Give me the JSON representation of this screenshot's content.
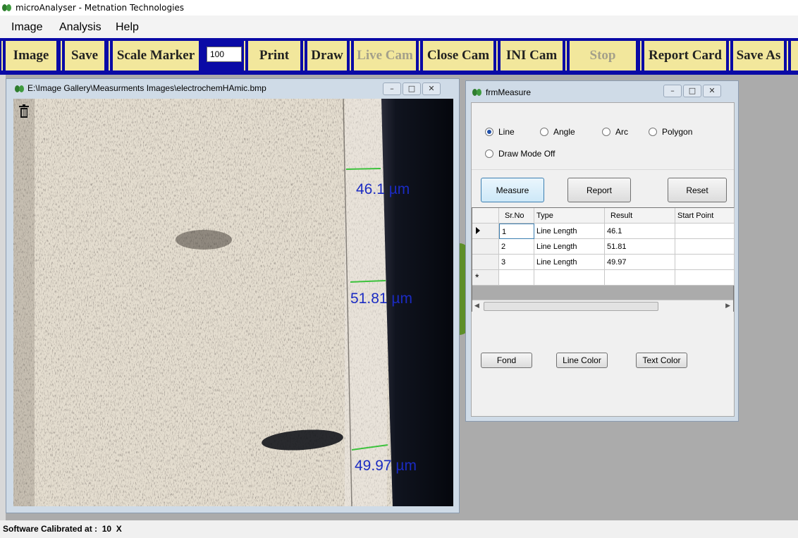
{
  "app": {
    "title": "microAnalyser - Metnation Technologies"
  },
  "menu": [
    "Image",
    "Analysis",
    "Help"
  ],
  "toolbar": {
    "buttons": [
      {
        "label": "Image"
      },
      {
        "label": "Save"
      },
      {
        "label": "Scale Marker"
      },
      {
        "label": "Print"
      },
      {
        "label": "Draw"
      },
      {
        "label": "Live Cam"
      },
      {
        "label": "Close Cam"
      },
      {
        "label": "INI Cam"
      },
      {
        "label": "Stop"
      },
      {
        "label": "Report Card"
      },
      {
        "label": "Save As"
      }
    ],
    "scale_value": "100"
  },
  "image_window": {
    "title": "E:\\Image Gallery\\Measurments Images\\electrochemHAmic.bmp",
    "measurements": [
      "46.1  µm",
      "51.81  µm",
      "49.97  µm"
    ]
  },
  "measure_window": {
    "title": "frmMeasure",
    "radios": [
      {
        "label": "Line",
        "selected": true
      },
      {
        "label": "Angle",
        "selected": false
      },
      {
        "label": "Arc",
        "selected": false
      },
      {
        "label": "Polygon",
        "selected": false
      },
      {
        "label": "Draw Mode Off",
        "selected": false
      }
    ],
    "buttons": {
      "measure": "Measure",
      "report": "Report",
      "reset": "Reset",
      "fond": "Fond",
      "line_color": "Line Color",
      "text_color": "Text Color"
    },
    "grid": {
      "columns": [
        "Sr.No",
        "Type",
        "Result",
        "Start Point"
      ],
      "rows": [
        [
          "1",
          "Line Length",
          "46.1",
          ""
        ],
        [
          "2",
          "Line Length",
          "51.81",
          ""
        ],
        [
          "3",
          "Line Length",
          "49.97",
          ""
        ]
      ],
      "new_row_marker": "*"
    }
  },
  "window_controls": {
    "minimize": "–",
    "maximize": "□",
    "close": "✕"
  },
  "status": {
    "text": "Software Calibrated at :  10  X"
  },
  "colors": {
    "toolbar_bg": "#0a0aa6",
    "toolbar_button": "#f2e79c",
    "measure_text": "#1b2bc2",
    "measure_line": "#3cc23c"
  }
}
